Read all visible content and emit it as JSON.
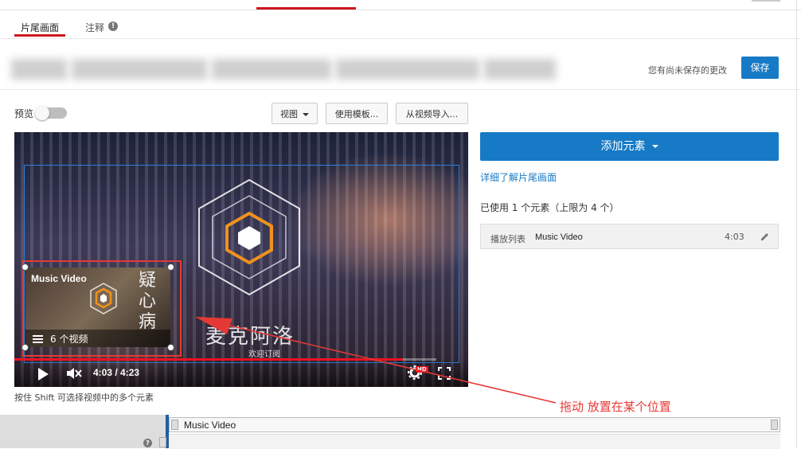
{
  "tabs": {
    "end_screen": "片尾画面",
    "annotations": "注释",
    "info_icon": "!"
  },
  "header": {
    "unsaved": "您有尚未保存的更改",
    "save": "保存"
  },
  "toolbar": {
    "preview": "预览",
    "view": "视图",
    "use_template": "使用模板...",
    "import_from_video": "从视频导入..."
  },
  "video": {
    "element_title": "Music Video",
    "element_count": "6 个视频",
    "channel_text": "麦克阿洛",
    "channel_sub": "欢迎订阅",
    "element_glyph": "疑心病",
    "time": "4:03 / 4:23",
    "hd_badge": "HD",
    "playback_progress": 0.92
  },
  "help": "按住 Shift 可选择视频中的多个元素",
  "panel": {
    "add_element": "添加元素",
    "learn_more": "详细了解片尾画面",
    "usage": "已使用 1 个元素（上限为 4 个）",
    "element": {
      "type": "播放列表",
      "name": "Music Video",
      "time": "4:03"
    }
  },
  "annotation": {
    "text": "拖动  放置在某个位置",
    "color": "#e53935"
  },
  "timeline": {
    "label": "Music Video",
    "help_icon": "?"
  },
  "colors": {
    "accent": "#cc181e",
    "primary": "#167ac6"
  }
}
